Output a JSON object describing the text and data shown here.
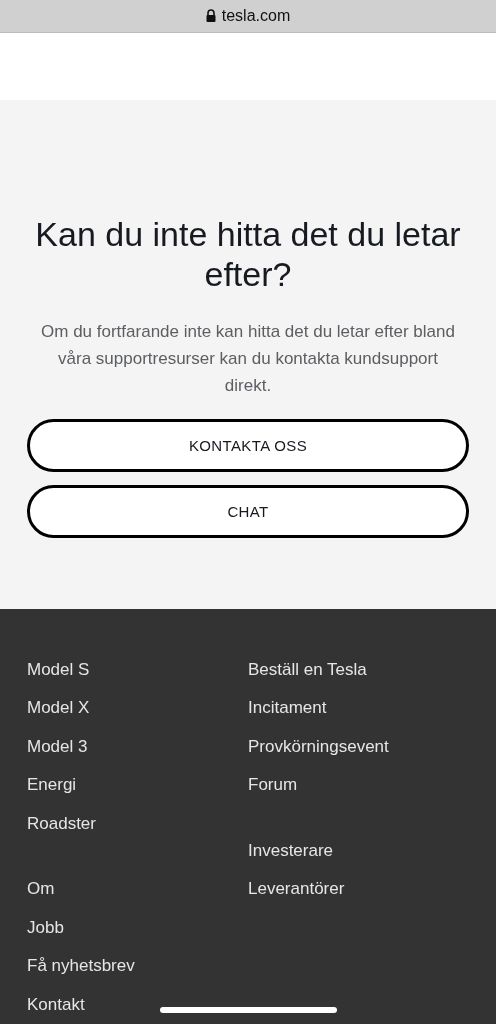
{
  "address_bar": {
    "url": "tesla.com"
  },
  "support": {
    "heading": "Kan du inte hitta det du letar efter?",
    "text": "Om du fortfarande inte kan hitta det du letar efter bland våra supportresurser kan du kontakta kundsupport direkt.",
    "buttons": [
      "KONTAKTA OSS",
      "CHAT"
    ]
  },
  "footer": {
    "columns": [
      [
        [
          "Model S",
          "Model X",
          "Model 3",
          "Energi",
          "Roadster"
        ],
        [
          "Om",
          "Jobb",
          "Få nyhetsbrev",
          "Kontakt"
        ]
      ],
      [
        [
          "Beställ en Tesla",
          "Incitament",
          "Provkörningsevent",
          "Forum"
        ],
        [
          "Investerare",
          "Leverantörer"
        ]
      ]
    ]
  }
}
